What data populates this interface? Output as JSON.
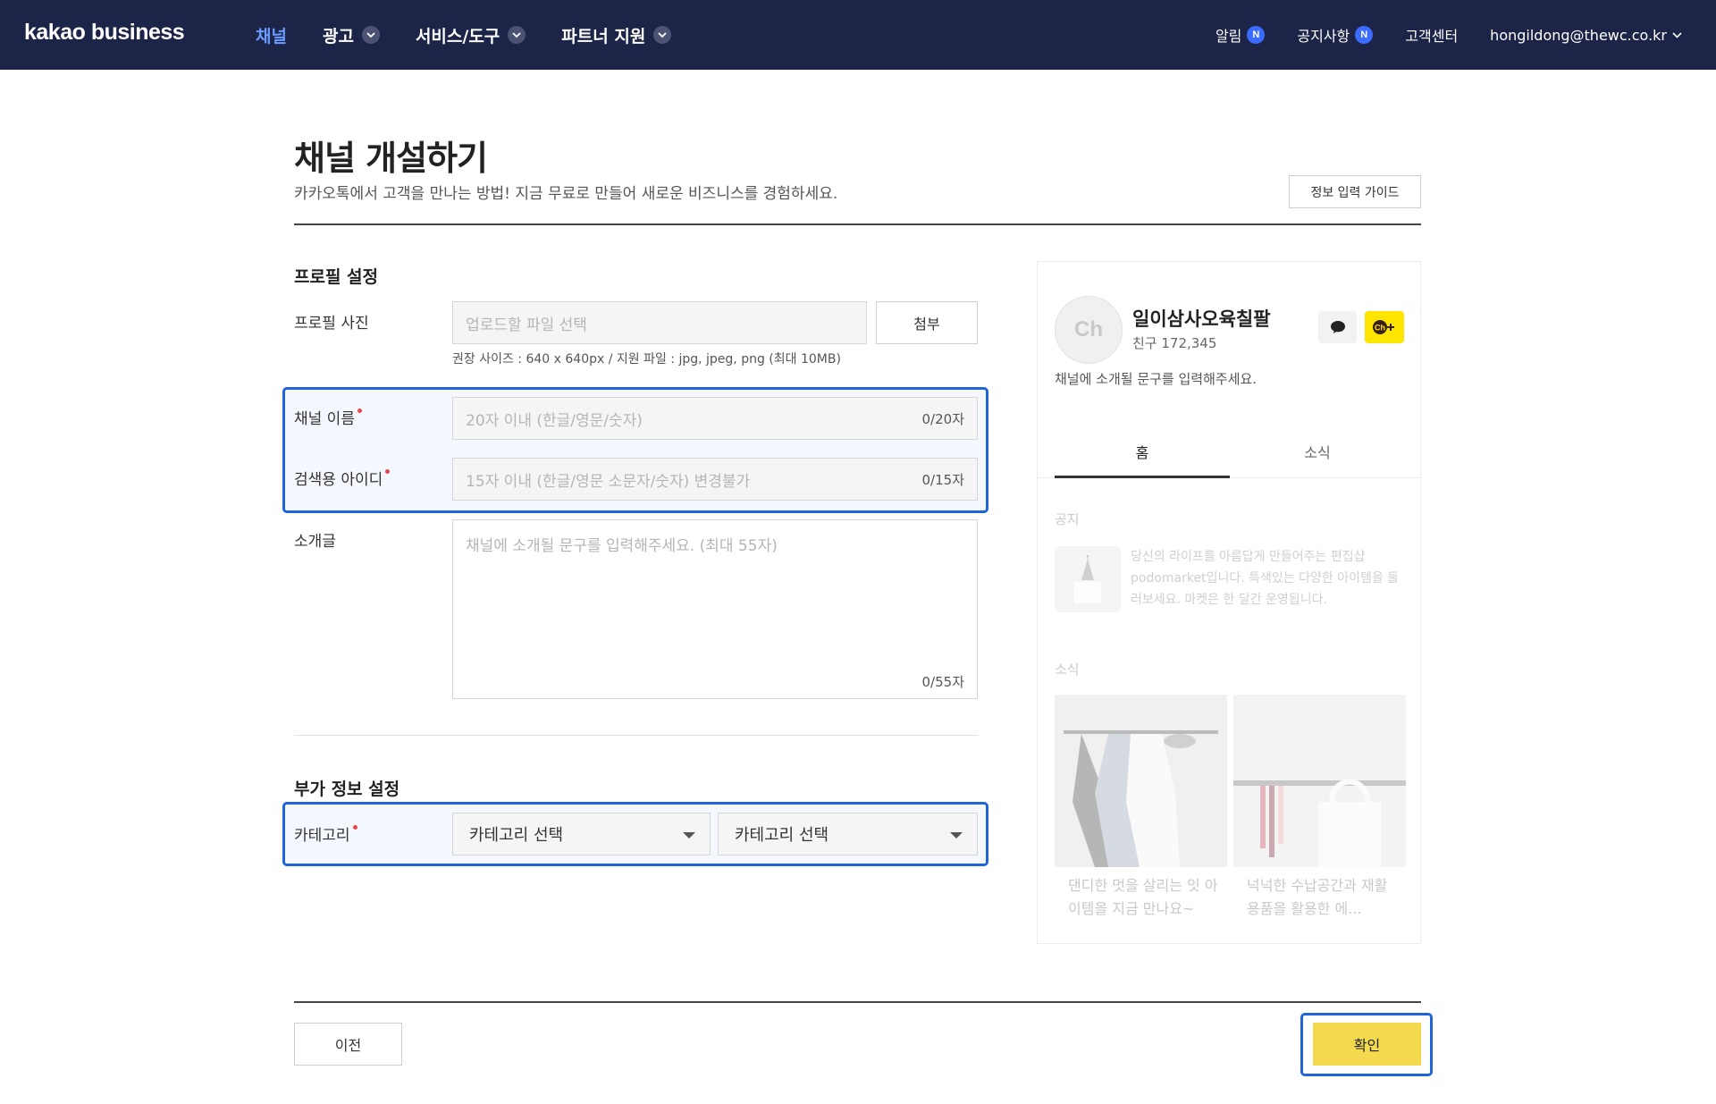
{
  "nav": {
    "logo": "kakao business",
    "items": [
      {
        "label": "채널",
        "active": true,
        "dropdown": false
      },
      {
        "label": "광고",
        "active": false,
        "dropdown": true
      },
      {
        "label": "서비스/도구",
        "active": false,
        "dropdown": true
      },
      {
        "label": "파트너 지원",
        "active": false,
        "dropdown": true
      }
    ],
    "alerts_label": "알림",
    "notices_label": "공지사항",
    "badge_text": "N",
    "support_label": "고객센터",
    "account_email": "hongildong@thewc.co.kr"
  },
  "header": {
    "title": "채널 개설하기",
    "subtitle": "카카오톡에서 고객을 만나는 방법! 지금 무료로 만들어 새로운 비즈니스를 경험하세요.",
    "guide_button": "정보 입력 가이드"
  },
  "profile": {
    "section_title": "프로필 설정",
    "photo_label": "프로필 사진",
    "photo_placeholder": "업로드할 파일 선택",
    "attach_button": "첨부",
    "photo_hint": "권장 사이즈 : 640 x 640px / 지원 파일 : jpg, jpeg, png (최대 10MB)",
    "channel_name_label": "채널 이름",
    "channel_name_placeholder": "20자 이내 (한글/영문/숫자)",
    "channel_name_counter": "0/20자",
    "search_id_label": "검색용 아이디",
    "search_id_placeholder": "15자 이내 (한글/영문 소문자/숫자) 변경불가",
    "search_id_counter": "0/15자",
    "intro_label": "소개글",
    "intro_placeholder": "채널에 소개될 문구를 입력해주세요. (최대 55자)",
    "intro_counter": "0/55자"
  },
  "extra": {
    "section_title": "부가 정보 설정",
    "category_label": "카테고리",
    "category1": "카테고리 선택",
    "category2": "카테고리 선택"
  },
  "preview": {
    "avatar_text": "Ch",
    "name": "일이삼사오육칠팔",
    "friends": "친구 172,345",
    "description": "채널에 소개될 문구를 입력해주세요.",
    "tab_home": "홈",
    "tab_news": "소식",
    "notice_title": "공지",
    "notice_text": "당신의 라이프를 아름답게 만들어주는 편집샵 podomarket입니다. 특색있는 다양한 아이템을 둘러보세요. 마켓은 한 달간 운영됩니다.",
    "news_title": "소식",
    "card1_text": "댄디한 멋을 살리는 잇 아이템을 지금 만나요~",
    "card2_text": "넉넉한 수납공간과 재활용품을 활용한 에..."
  },
  "footer": {
    "prev_button": "이전",
    "confirm_button": "확인"
  },
  "colors": {
    "nav_bg": "#1c2447",
    "nav_active": "#6b9bff",
    "badge": "#3b6bff",
    "highlight": "#1f64d8",
    "confirm": "#f2d94e",
    "kakao_yellow": "#fee500",
    "required": "#e8474b"
  }
}
